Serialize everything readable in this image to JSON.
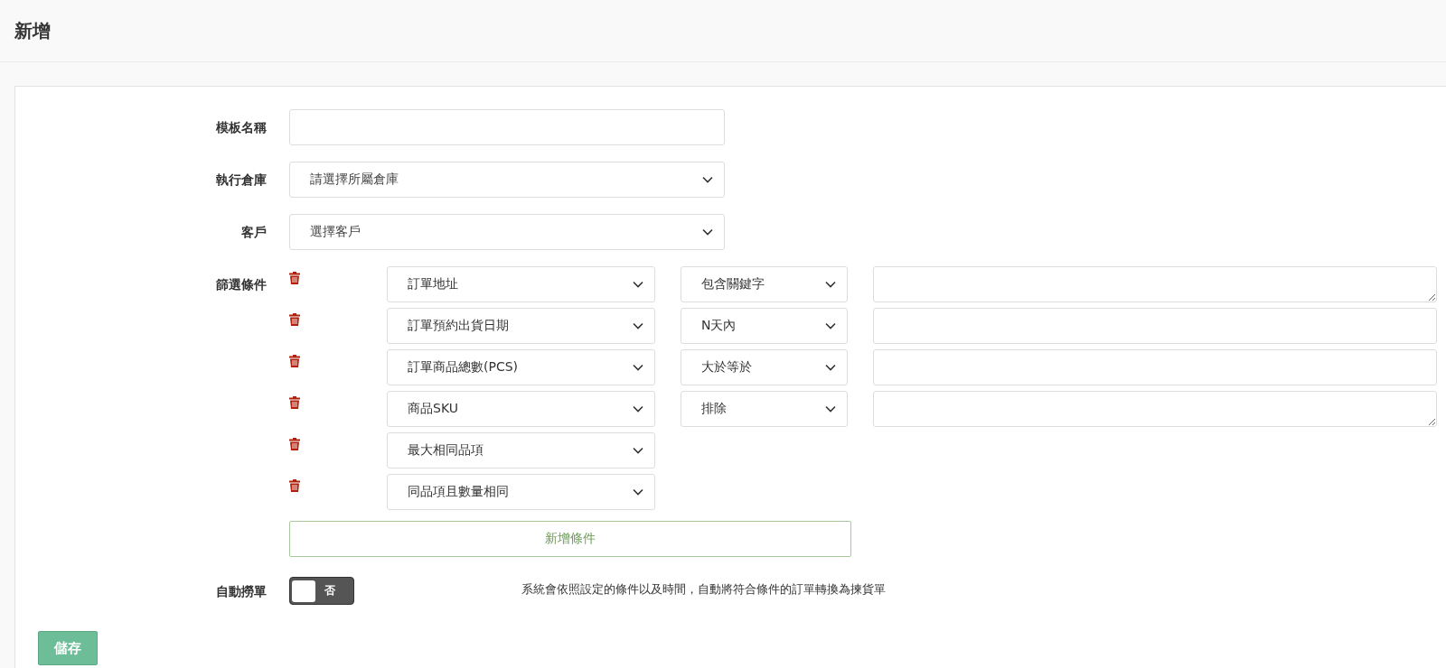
{
  "page": {
    "title": "新增"
  },
  "form": {
    "template_name": {
      "label": "模板名稱"
    },
    "warehouse": {
      "label": "執行倉庫",
      "value": "請選擇所屬倉庫"
    },
    "customer": {
      "label": "客戶",
      "value": "選擇客戶"
    },
    "filters": {
      "label": "篩選條件",
      "conditions": [
        {
          "kind": "textarea",
          "field": "訂單地址",
          "operator": "包含關鍵字"
        },
        {
          "kind": "input",
          "field": "訂單預約出貨日期",
          "operator": "N天內"
        },
        {
          "kind": "input",
          "field": "訂單商品總數(PCS)",
          "operator": "大於等於"
        },
        {
          "kind": "textarea",
          "field": "商品SKU",
          "operator": "排除"
        },
        {
          "kind": "field-only",
          "field": "最大相同品項"
        },
        {
          "kind": "field-only",
          "field": "同品項且數量相同"
        }
      ],
      "add_button": "新增條件"
    },
    "auto_pick": {
      "label": "自動撈單",
      "on": false,
      "toggle_text": "否",
      "hint": "系統會依照設定的條件以及時間，自動將符合條件的訂單轉換為揀貨單"
    },
    "save_button": "儲存"
  }
}
